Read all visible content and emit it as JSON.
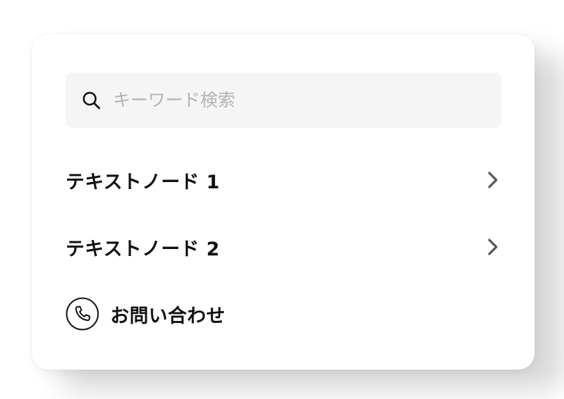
{
  "search": {
    "placeholder": "キーワード検索",
    "icon": "search-icon"
  },
  "nodes": [
    {
      "label": "テキストノード 1",
      "icon": "chevron-right-icon"
    },
    {
      "label": "テキストノード 2",
      "icon": "chevron-right-icon"
    }
  ],
  "contact": {
    "label": "お問い合わせ",
    "icon": "phone-icon"
  },
  "colors": {
    "background": "#ffffff",
    "search_bg": "#f5f5f5",
    "text": "#111111",
    "placeholder": "#b3b3b3",
    "chevron": "#555555"
  }
}
